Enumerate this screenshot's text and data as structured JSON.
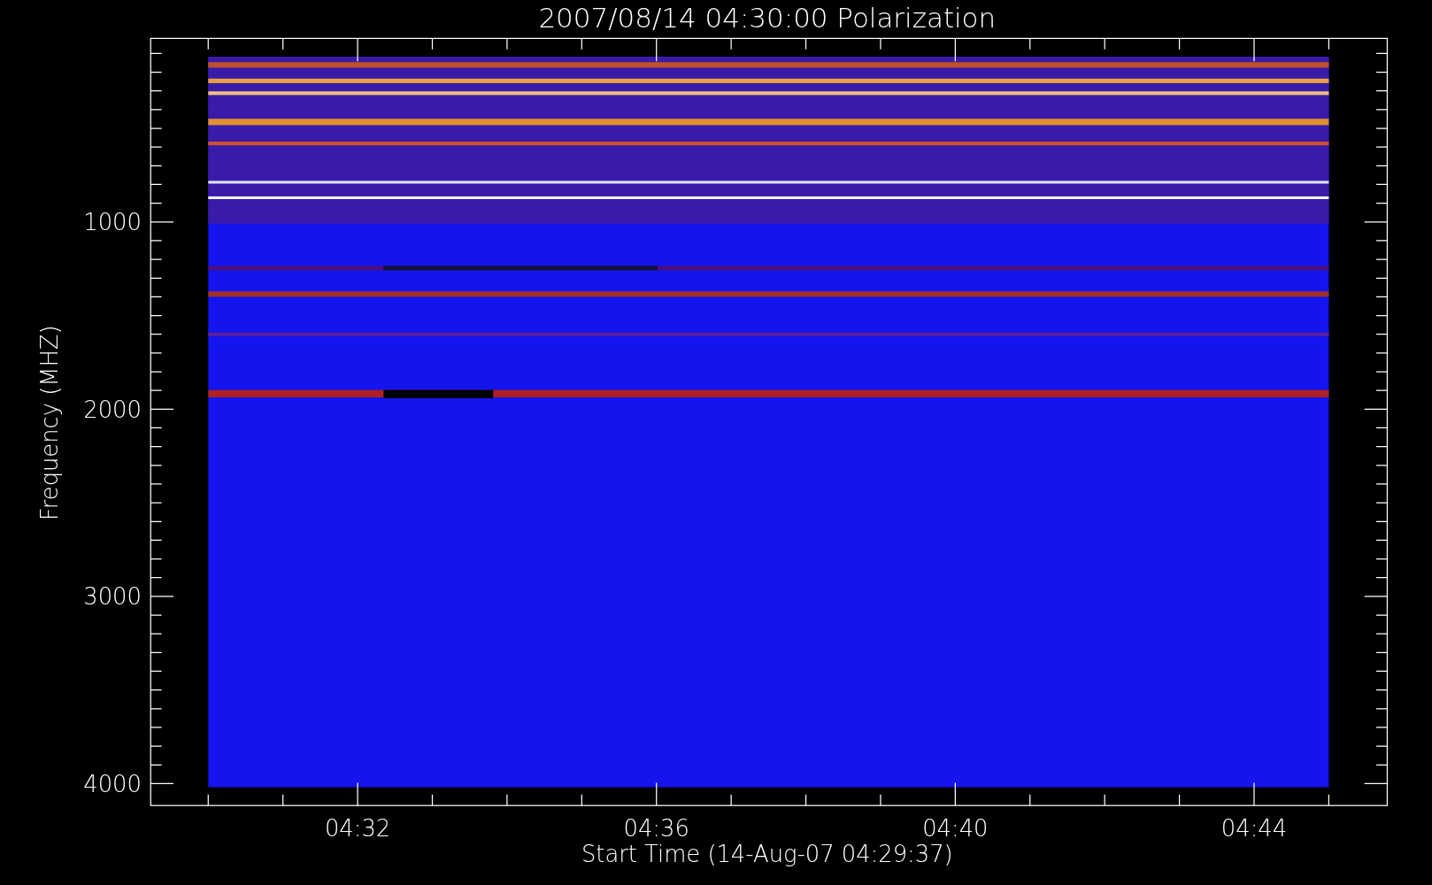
{
  "title": "2007/08/14 04:30:00 Polarization",
  "y_axis": {
    "label": "Frequency (MHZ)",
    "ticks": [
      "1000",
      "2000",
      "3000",
      "4000"
    ]
  },
  "x_axis": {
    "label": "Start Time (14-Aug-07 04:29:37)",
    "ticks": [
      "04:32",
      "04:36",
      "04:40",
      "04:44"
    ]
  }
}
